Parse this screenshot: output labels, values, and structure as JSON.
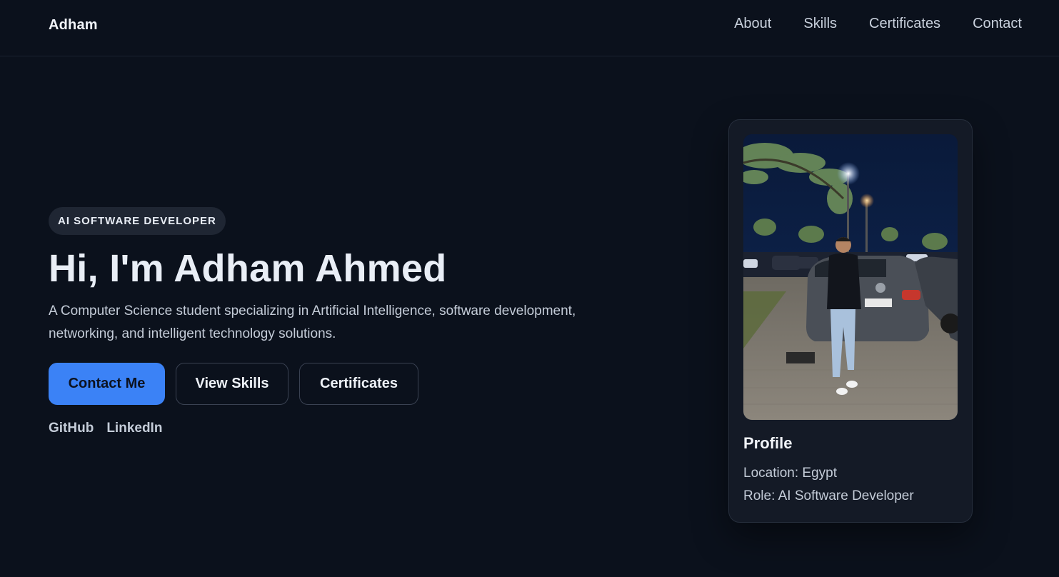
{
  "nav": {
    "brand": "Adham",
    "links": [
      "About",
      "Skills",
      "Certificates",
      "Contact"
    ]
  },
  "hero": {
    "badge": "AI SOFTWARE DEVELOPER",
    "title": "Hi, I'm Adham Ahmed",
    "description": "A Computer Science student specializing in Artificial Intelligence, software development, networking, and intelligent technology solutions.",
    "buttons": {
      "contact": "Contact Me",
      "skills": "View Skills",
      "certificates": "Certificates"
    },
    "socials": [
      "GitHub",
      "LinkedIn"
    ]
  },
  "profile": {
    "title": "Profile",
    "location_label": "Location:",
    "location": "Egypt",
    "role_label": "Role:",
    "role": "AI Software Developer"
  },
  "colors": {
    "background": "#0b111c",
    "accent": "#3b82f6",
    "card": "#141a26"
  }
}
